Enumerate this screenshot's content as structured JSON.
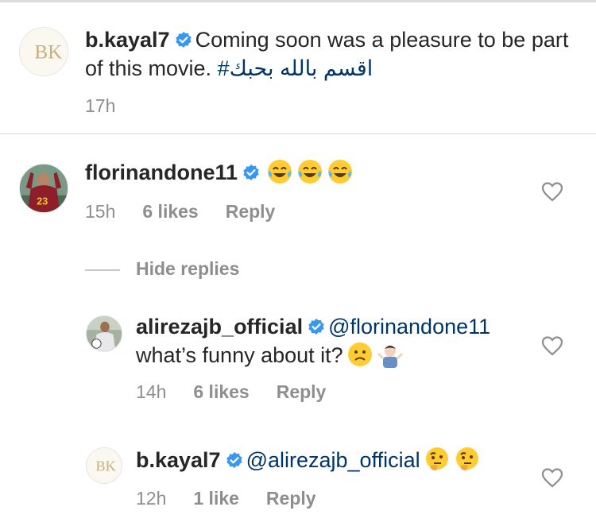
{
  "post": {
    "username": "b.kayal7",
    "caption": "Coming soon was a pleasure to be part of this movie.",
    "hashtag": "#اقسم بالله بحبك",
    "time": "17h",
    "avatar_letters": "BK"
  },
  "comment": {
    "username": "florinandone11",
    "emoji": [
      "face-with-tears-of-joy",
      "face-with-tears-of-joy",
      "face-with-tears-of-joy"
    ],
    "time": "15h",
    "likes": "6 likes",
    "reply": "Reply",
    "jersey_number": "23"
  },
  "hide_replies": "Hide replies",
  "replies": [
    {
      "username": "alirezajb_official",
      "mention": "@florinandone11",
      "text": "what’s funny about it?",
      "emoji": [
        "slightly-frowning-face",
        "person-shrugging"
      ],
      "time": "14h",
      "likes": "6 likes",
      "reply": "Reply"
    },
    {
      "username": "b.kayal7",
      "mention": "@alirezajb_official",
      "emoji": [
        "thinking-face",
        "thinking-face"
      ],
      "time": "12h",
      "likes": "1 like",
      "reply": "Reply",
      "avatar_letters": "BK"
    }
  ],
  "colors": {
    "text": "#262626",
    "meta": "#8e8e8e",
    "link": "#003569",
    "verified": "#3897f0",
    "divider": "#dbdbdb"
  }
}
